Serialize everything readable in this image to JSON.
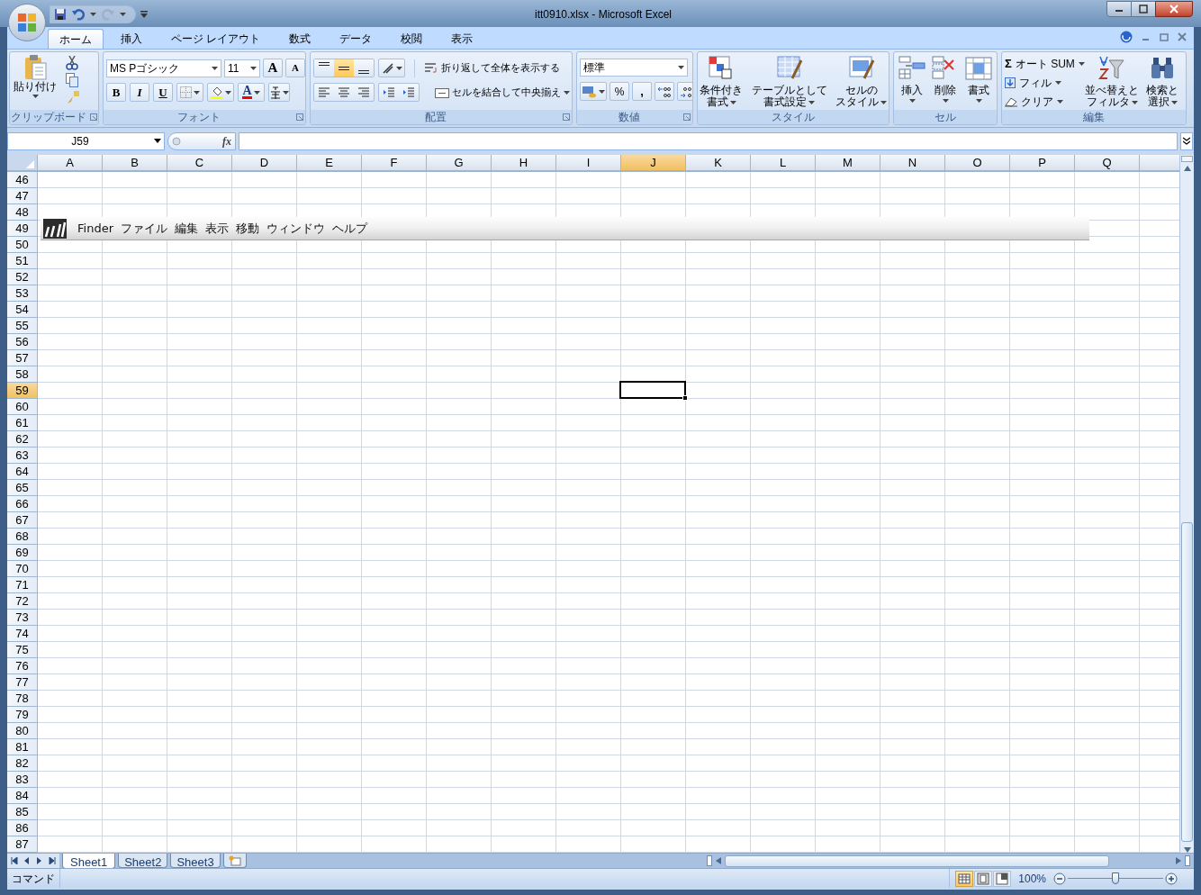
{
  "window": {
    "title": "itt0910.xlsx - Microsoft Excel"
  },
  "ribbon_tabs": [
    {
      "label": "ホーム",
      "selected": true
    },
    {
      "label": "挿入",
      "selected": false
    },
    {
      "label": "ページ レイアウト",
      "selected": false
    },
    {
      "label": "数式",
      "selected": false
    },
    {
      "label": "データ",
      "selected": false
    },
    {
      "label": "校閲",
      "selected": false
    },
    {
      "label": "表示",
      "selected": false
    }
  ],
  "clipboard": {
    "paste": "貼り付け",
    "label": "クリップボード"
  },
  "font": {
    "name": "MS Pゴシック",
    "size": "11",
    "grow": "A",
    "shrink": "A",
    "styles": [
      "B",
      "I",
      "U"
    ],
    "font_color": "A",
    "label": "フォント"
  },
  "alignment": {
    "vertical": [
      {
        "selected": false
      },
      {
        "selected": true
      },
      {
        "selected": false
      }
    ],
    "wrap_text": "折り返して全体を表示する",
    "merge_center": "セルを結合して中央揃え",
    "label": "配置"
  },
  "number": {
    "format": "標準",
    "percent": "%",
    "comma": ",",
    "label": "数値"
  },
  "styles": {
    "buttons": [
      {
        "lines": [
          "条件付き",
          "書式"
        ]
      },
      {
        "lines": [
          "テーブルとして",
          "書式設定"
        ]
      },
      {
        "lines": [
          "セルの",
          "スタイル"
        ]
      }
    ],
    "label": "スタイル"
  },
  "cells": {
    "buttons": [
      {
        "label": "挿入"
      },
      {
        "label": "削除"
      },
      {
        "label": "書式"
      }
    ],
    "label": "セル"
  },
  "editing": {
    "sigma": "Σ",
    "small": [
      "オート SUM",
      "フィル",
      "クリア"
    ],
    "big": [
      {
        "lines": [
          "並べ替えと",
          "フィルタ"
        ]
      },
      {
        "lines": [
          "検索と",
          "選択"
        ]
      }
    ],
    "label": "編集"
  },
  "formula_bar": {
    "name_box": "J59",
    "function_label": "fx"
  },
  "grid": {
    "columns": [
      {
        "label": "A",
        "selected": false
      },
      {
        "label": "B",
        "selected": false
      },
      {
        "label": "C",
        "selected": false
      },
      {
        "label": "D",
        "selected": false
      },
      {
        "label": "E",
        "selected": false
      },
      {
        "label": "F",
        "selected": false
      },
      {
        "label": "G",
        "selected": false
      },
      {
        "label": "H",
        "selected": false
      },
      {
        "label": "I",
        "selected": false
      },
      {
        "label": "J",
        "selected": true
      },
      {
        "label": "K",
        "selected": false
      },
      {
        "label": "L",
        "selected": false
      },
      {
        "label": "M",
        "selected": false
      },
      {
        "label": "N",
        "selected": false
      },
      {
        "label": "O",
        "selected": false
      },
      {
        "label": "P",
        "selected": false
      },
      {
        "label": "Q",
        "selected": false
      }
    ],
    "rows": [
      {
        "label": "46",
        "selected": false
      },
      {
        "label": "47",
        "selected": false
      },
      {
        "label": "48",
        "selected": false
      },
      {
        "label": "49",
        "selected": false
      },
      {
        "label": "50",
        "selected": false
      },
      {
        "label": "51",
        "selected": false
      },
      {
        "label": "52",
        "selected": false
      },
      {
        "label": "53",
        "selected": false
      },
      {
        "label": "54",
        "selected": false
      },
      {
        "label": "55",
        "selected": false
      },
      {
        "label": "56",
        "selected": false
      },
      {
        "label": "57",
        "selected": false
      },
      {
        "label": "58",
        "selected": false
      },
      {
        "label": "59",
        "selected": true
      },
      {
        "label": "60",
        "selected": false
      },
      {
        "label": "61",
        "selected": false
      },
      {
        "label": "62",
        "selected": false
      },
      {
        "label": "63",
        "selected": false
      },
      {
        "label": "64",
        "selected": false
      },
      {
        "label": "65",
        "selected": false
      },
      {
        "label": "66",
        "selected": false
      },
      {
        "label": "67",
        "selected": false
      },
      {
        "label": "68",
        "selected": false
      },
      {
        "label": "69",
        "selected": false
      },
      {
        "label": "70",
        "selected": false
      },
      {
        "label": "71",
        "selected": false
      },
      {
        "label": "72",
        "selected": false
      },
      {
        "label": "73",
        "selected": false
      },
      {
        "label": "74",
        "selected": false
      },
      {
        "label": "75",
        "selected": false
      },
      {
        "label": "76",
        "selected": false
      },
      {
        "label": "77",
        "selected": false
      },
      {
        "label": "78",
        "selected": false
      },
      {
        "label": "79",
        "selected": false
      },
      {
        "label": "80",
        "selected": false
      },
      {
        "label": "81",
        "selected": false
      },
      {
        "label": "82",
        "selected": false
      },
      {
        "label": "83",
        "selected": false
      },
      {
        "label": "84",
        "selected": false
      },
      {
        "label": "85",
        "selected": false
      },
      {
        "label": "86",
        "selected": false
      },
      {
        "label": "87",
        "selected": false
      }
    ]
  },
  "embedded_picture": {
    "menu": [
      "Finder",
      "ファイル",
      "編集",
      "表示",
      "移動",
      "ウィンドウ",
      "ヘルプ"
    ]
  },
  "sheet_tabs": [
    {
      "label": "Sheet1",
      "selected": true
    },
    {
      "label": "Sheet2",
      "selected": false
    },
    {
      "label": "Sheet3",
      "selected": false
    }
  ],
  "status_bar": {
    "mode": "コマンド",
    "views": [
      {
        "selected": true
      },
      {
        "selected": false
      },
      {
        "selected": false
      }
    ],
    "zoom": "100%",
    "zoom_slider": {
      "level": 0.5
    }
  }
}
